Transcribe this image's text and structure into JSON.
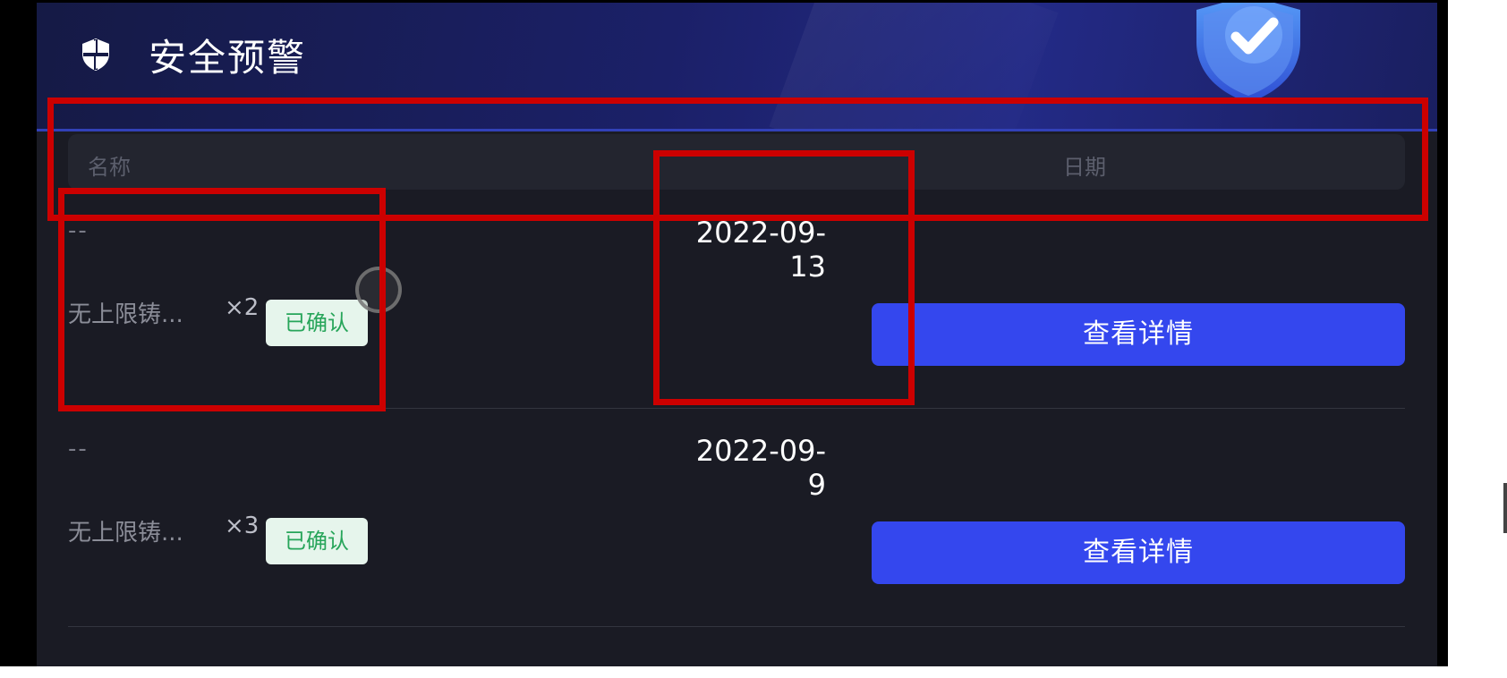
{
  "header": {
    "title": "安全预警"
  },
  "table": {
    "columns": {
      "name": "名称",
      "date": "日期"
    },
    "rows": [
      {
        "category": "--",
        "name": "无上限铸...",
        "count": "×2",
        "status": "已确认",
        "date_line1": "2022-09-",
        "date_line2": "13",
        "action": "查看详情"
      },
      {
        "category": "--",
        "name": "无上限铸...",
        "count": "×3",
        "status": "已确认",
        "date_line1": "2022-09-",
        "date_line2": "9",
        "action": "查看详情"
      }
    ]
  },
  "colors": {
    "accent_button": "#3447ee",
    "status_badge_bg": "#e6f5ec",
    "status_badge_text": "#27a55a",
    "annotation_box": "#cc0000",
    "background": "#1a1b24"
  },
  "icons": {
    "header": "shield-icon",
    "decoration": "shield-check-icon"
  }
}
